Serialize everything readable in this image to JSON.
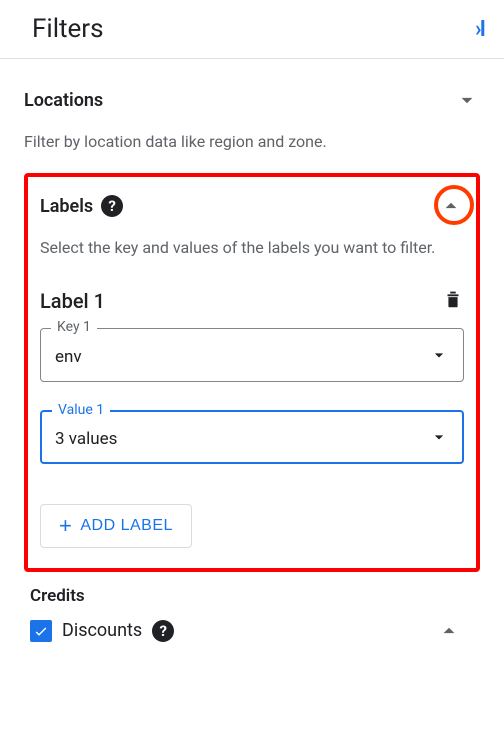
{
  "header": {
    "title": "Filters"
  },
  "locations": {
    "title": "Locations",
    "description": "Filter by location data like region and zone."
  },
  "labels": {
    "title": "Labels",
    "description": "Select the key and values of the labels you want to filter.",
    "items": [
      {
        "title": "Label 1",
        "key_legend": "Key 1",
        "key_value": "env",
        "value_legend": "Value 1",
        "value_value": "3 values"
      }
    ],
    "add_button": "ADD LABEL"
  },
  "credits": {
    "title": "Credits",
    "discounts": "Discounts"
  }
}
